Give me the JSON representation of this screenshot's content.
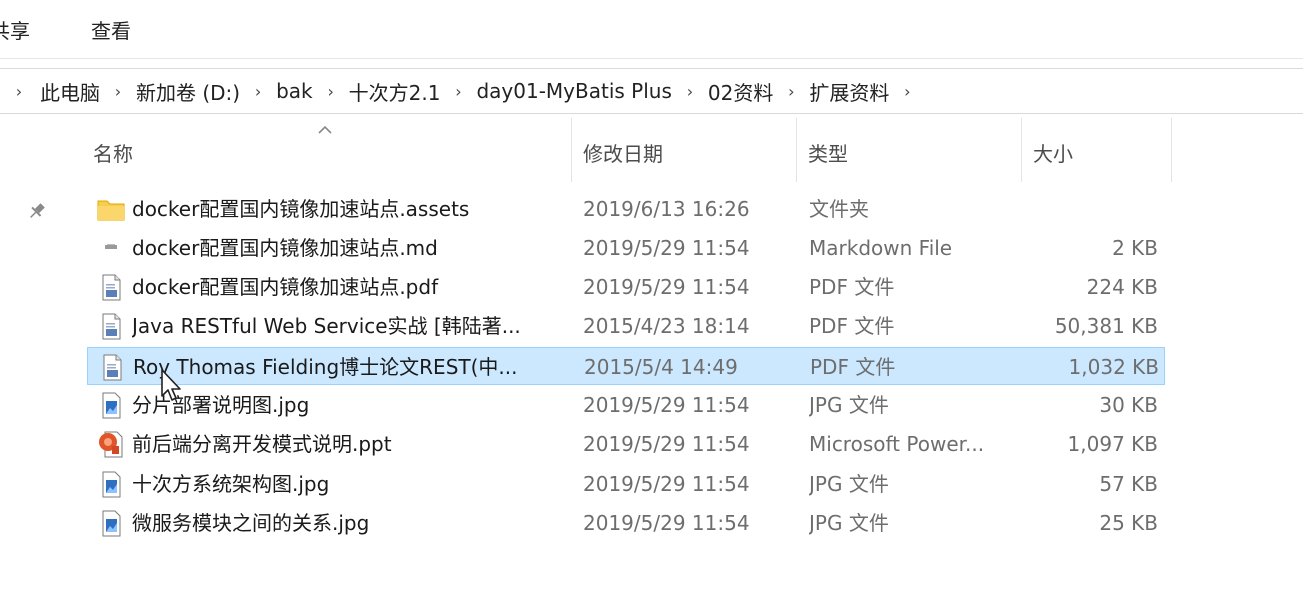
{
  "ribbon": {
    "tabs": [
      {
        "label": "共享"
      },
      {
        "label": "查看"
      }
    ]
  },
  "breadcrumb": {
    "items": [
      "此电脑",
      "新加卷 (D:)",
      "bak",
      "十次方2.1",
      "day01-MyBatis Plus",
      "02资料",
      "扩展资料"
    ],
    "separator": "›"
  },
  "columns": {
    "name": "名称",
    "date": "修改日期",
    "type": "类型",
    "size": "大小"
  },
  "files": [
    {
      "name": "docker配置国内镜像加速站点.assets",
      "date": "2019/6/13 16:26",
      "type": "文件夹",
      "size": "",
      "icon": "folder-icon"
    },
    {
      "name": "docker配置国内镜像加速站点.md",
      "date": "2019/5/29 11:54",
      "type": "Markdown File",
      "size": "2 KB",
      "icon": "markdown-file-icon"
    },
    {
      "name": "docker配置国内镜像加速站点.pdf",
      "date": "2019/5/29 11:54",
      "type": "PDF 文件",
      "size": "224 KB",
      "icon": "pdf-file-icon"
    },
    {
      "name": "Java RESTful Web Service实战 [韩陆著...",
      "date": "2015/4/23 18:14",
      "type": "PDF 文件",
      "size": "50,381 KB",
      "icon": "pdf-file-icon"
    },
    {
      "name": "Roy Thomas Fielding博士论文REST(中...",
      "date": "2015/5/4 14:49",
      "type": "PDF 文件",
      "size": "1,032 KB",
      "icon": "pdf-file-icon",
      "selected": true
    },
    {
      "name": "分片部署说明图.jpg",
      "date": "2019/5/29 11:54",
      "type": "JPG 文件",
      "size": "30 KB",
      "icon": "image-file-icon"
    },
    {
      "name": "前后端分离开发模式说明.ppt",
      "date": "2019/5/29 11:54",
      "type": "Microsoft Power...",
      "size": "1,097 KB",
      "icon": "powerpoint-file-icon"
    },
    {
      "name": "十次方系统架构图.jpg",
      "date": "2019/5/29 11:54",
      "type": "JPG 文件",
      "size": "57 KB",
      "icon": "image-file-icon"
    },
    {
      "name": "微服务模块之间的关系.jpg",
      "date": "2019/5/29 11:54",
      "type": "JPG 文件",
      "size": "25 KB",
      "icon": "image-file-icon"
    }
  ],
  "colors": {
    "selection_bg": "#cce8ff",
    "selection_border": "#99d1ff",
    "folder": "#f5c518"
  }
}
